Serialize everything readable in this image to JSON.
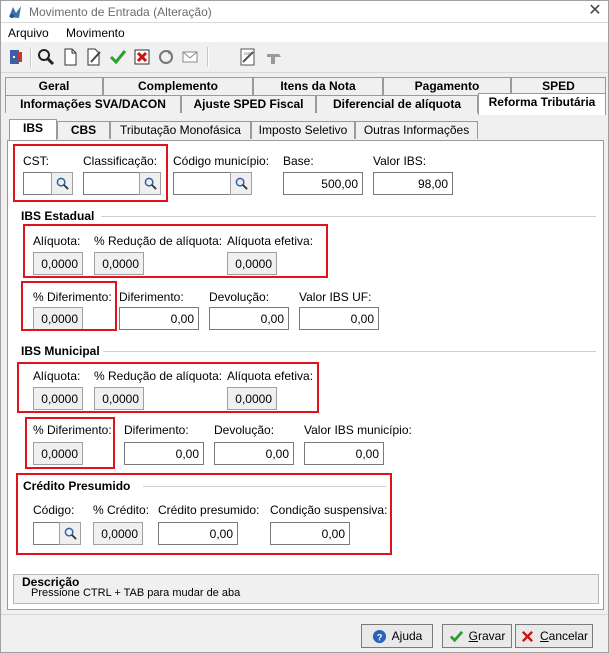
{
  "window": {
    "title": "Movimento de Entrada (Alteração)"
  },
  "menu": [
    "Arquivo",
    "Movimento"
  ],
  "tabs_top": [
    "Geral",
    "Complemento",
    "Itens da Nota",
    "Pagamento",
    "SPED"
  ],
  "tabs_second": [
    "Informações SVA/DACON",
    "Ajuste SPED Fiscal",
    "Diferencial de alíquota",
    "Reforma Tributária"
  ],
  "subtabs": [
    "IBS",
    "CBS",
    "Tributação Monofásica",
    "Imposto Seletivo",
    "Outras Informações"
  ],
  "ibs": {
    "cst_label": "CST:",
    "classificacao_label": "Classificação:",
    "codigo_municipio_label": "Código município:",
    "base_label": "Base:",
    "base_value": "500,00",
    "valor_ibs_label": "Valor IBS:",
    "valor_ibs_value": "98,00"
  },
  "ibs_estadual": {
    "title": "IBS Estadual",
    "aliquota_label": "Alíquota:",
    "aliquota_value": "0,0000",
    "reducao_label": "% Redução de alíquota:",
    "reducao_value": "0,0000",
    "efetiva_label": "Alíquota efetiva:",
    "efetiva_value": "0,0000",
    "pct_diferimento_label": "% Diferimento:",
    "pct_diferimento_value": "0,0000",
    "diferimento_label": "Diferimento:",
    "diferimento_value": "0,00",
    "devolucao_label": "Devolução:",
    "devolucao_value": "0,00",
    "valor_label": "Valor IBS UF:",
    "valor_value": "0,00"
  },
  "ibs_municipal": {
    "title": "IBS Municipal",
    "aliquota_label": "Alíquota:",
    "aliquota_value": "0,0000",
    "reducao_label": "% Redução de alíquota:",
    "reducao_value": "0,0000",
    "efetiva_label": "Alíquota efetiva:",
    "efetiva_value": "0,0000",
    "pct_diferimento_label": "% Diferimento:",
    "pct_diferimento_value": "0,0000",
    "diferimento_label": "Diferimento:",
    "diferimento_value": "0,00",
    "devolucao_label": "Devolução:",
    "devolucao_value": "0,00",
    "valor_label": "Valor IBS município:",
    "valor_value": "0,00"
  },
  "credito_presumido": {
    "title": "Crédito Presumido",
    "codigo_label": "Código:",
    "pct_credito_label": "% Crédito:",
    "pct_credito_value": "0,0000",
    "credito_label": "Crédito presumido:",
    "credito_value": "0,00",
    "condicao_label": "Condição suspensiva:",
    "condicao_value": "0,00"
  },
  "descricao": {
    "title": "Descrição",
    "text": "Pressione CTRL + TAB para  mudar de aba"
  },
  "buttons": {
    "ajuda_pre": "A",
    "ajuda_u": "j",
    "ajuda_post": "uda",
    "gravar_u": "G",
    "gravar_post": "ravar",
    "cancelar_u": "C",
    "cancelar_post": "ancelar"
  },
  "toolbar_icons": [
    "exit-door-icon",
    "search-icon",
    "new-document-icon",
    "edit-document-icon",
    "confirm-check-icon",
    "cancel-document-icon",
    "refresh-icon",
    "email-icon",
    "iss-icon",
    "print-icon"
  ],
  "colors": {
    "highlight_box": "#e0121b",
    "confirm_green": "#2aa12a",
    "cancel_red": "#cc1111"
  }
}
